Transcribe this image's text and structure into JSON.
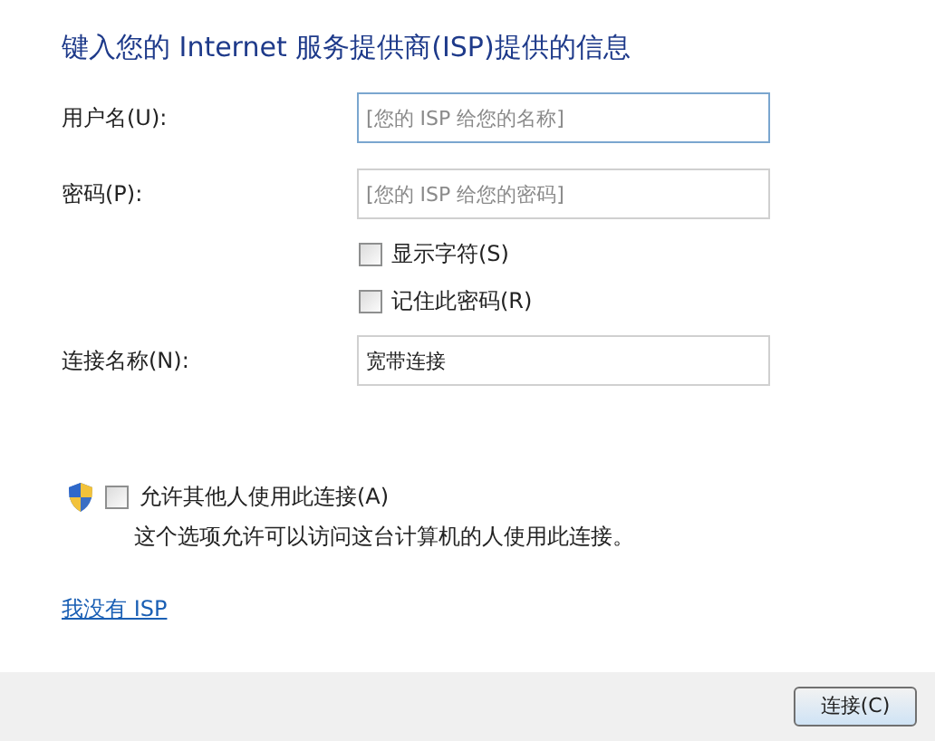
{
  "title": "键入您的 Internet 服务提供商(ISP)提供的信息",
  "fields": [
    {
      "label": "用户名(U):",
      "placeholder": "[您的 ISP 给您的名称]",
      "focused": true
    },
    {
      "label": "密码(P):",
      "placeholder": "[您的 ISP 给您的密码]",
      "focused": false
    }
  ],
  "options": [
    {
      "label": "显示字符(S)",
      "checked": false
    },
    {
      "label": "记住此密码(R)",
      "checked": false
    }
  ],
  "connection_name": {
    "label": "连接名称(N):",
    "value": "宽带连接"
  },
  "allow_others": {
    "label": "允许其他人使用此连接(A)",
    "checked": false,
    "description": "这个选项允许可以访问这台计算机的人使用此连接。"
  },
  "link": "我没有 ISP",
  "buttons": [
    "连接(C)"
  ]
}
